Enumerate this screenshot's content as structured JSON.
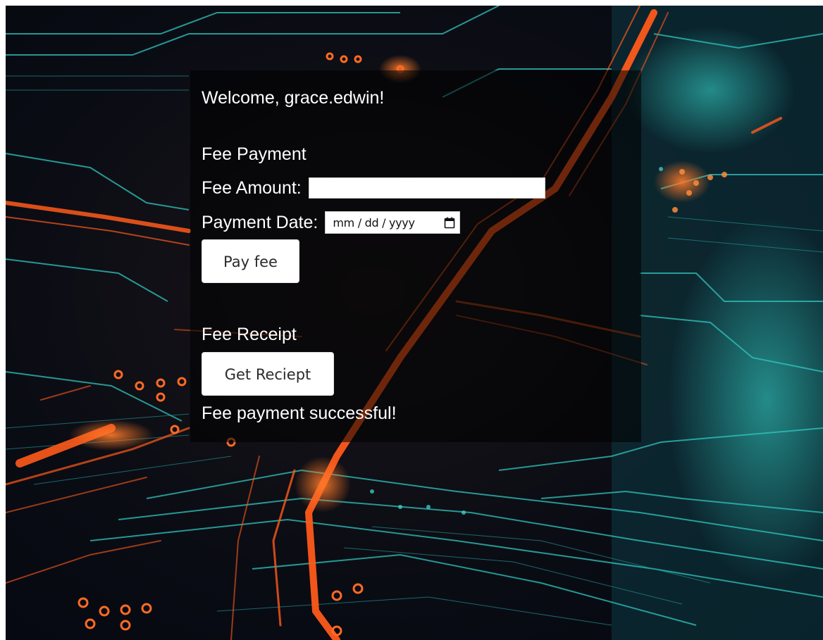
{
  "welcome": {
    "text": "Welcome, grace.edwin!"
  },
  "fee_payment": {
    "title": "Fee Payment",
    "amount_label": "Fee Amount:",
    "amount_value": "",
    "date_label": "Payment Date:",
    "date_placeholder": "mm / dd / yyyy",
    "date_icon": "calendar-icon",
    "pay_button": "Pay fee"
  },
  "fee_receipt": {
    "title": "Fee Receipt",
    "receipt_button": "Get Reciept"
  },
  "status": {
    "message": "Fee payment successful!"
  },
  "colors": {
    "panel": "#000000",
    "text": "#ffffff",
    "accent_orange": "#ff5a1a",
    "accent_teal": "#2fd3c8"
  }
}
